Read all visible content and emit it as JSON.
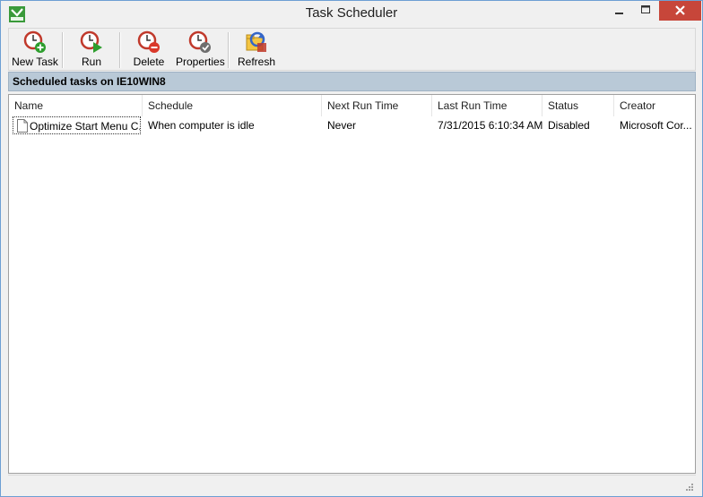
{
  "window": {
    "title": "Task Scheduler"
  },
  "toolbar": {
    "buttons": [
      {
        "label": "New Task",
        "icon": "clock-add-icon"
      },
      {
        "label": "Run",
        "icon": "clock-run-icon"
      },
      {
        "label": "Delete",
        "icon": "clock-delete-icon"
      },
      {
        "label": "Properties",
        "icon": "clock-properties-icon"
      },
      {
        "label": "Refresh",
        "icon": "refresh-icon"
      }
    ]
  },
  "section": {
    "title": "Scheduled tasks on IE10WIN8"
  },
  "table": {
    "columns": [
      "Name",
      "Schedule",
      "Next Run Time",
      "Last Run Time",
      "Status",
      "Creator"
    ],
    "rows": [
      [
        "Optimize Start Menu C...",
        "When computer is idle",
        "Never",
        "7/31/2015 6:10:34 AM",
        "Disabled",
        "Microsoft Cor..."
      ]
    ]
  },
  "colors": {
    "close_button": "#c7463a",
    "section_header": "#b9c9d7",
    "window_border": "#6d9fd3"
  }
}
